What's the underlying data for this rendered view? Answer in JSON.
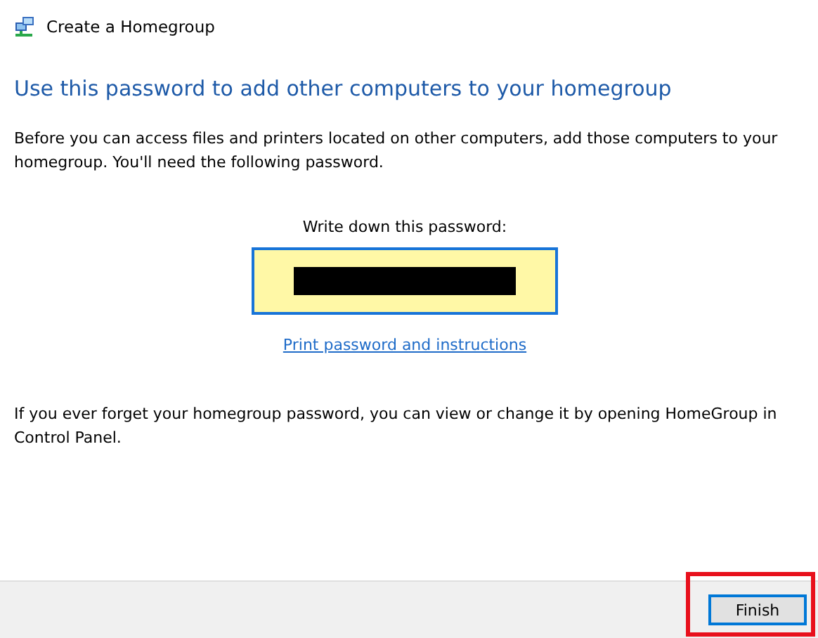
{
  "window": {
    "title": "Create a Homegroup"
  },
  "heading": "Use this password to add other computers to your homegroup",
  "intro": "Before you can access files and printers located on other computers, add those computers to your homegroup. You'll need the following password.",
  "password": {
    "label": "Write down this password:",
    "redacted": true
  },
  "print_link": "Print password and instructions",
  "note": "If you ever forget your homegroup password, you can view or change it by opening HomeGroup in Control Panel.",
  "buttons": [
    {
      "label": "Finish",
      "focused": true,
      "highlighted": true
    }
  ]
}
